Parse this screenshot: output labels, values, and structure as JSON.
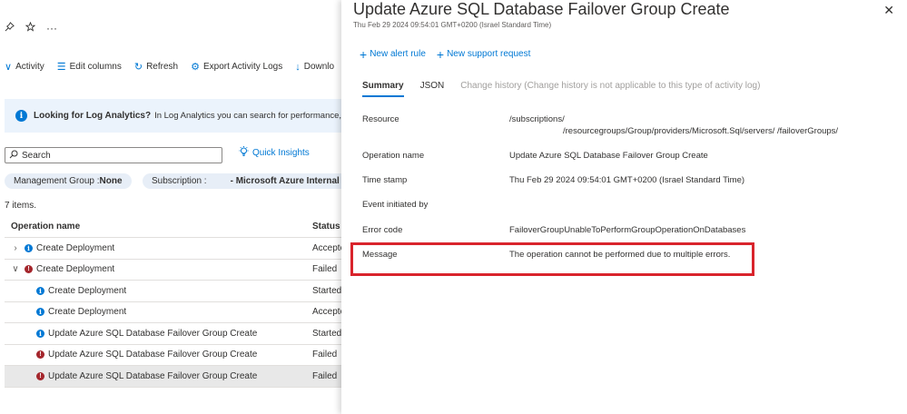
{
  "left": {
    "pin_icons": [
      "pin-icon",
      "star-icon",
      "more-icon"
    ],
    "more_label": "···",
    "toolbar": [
      {
        "label": "Activity",
        "icon": "chevron-down-icon",
        "glyph": "∨"
      },
      {
        "label": "Edit columns",
        "icon": "columns-icon",
        "glyph": "☰"
      },
      {
        "label": "Refresh",
        "icon": "refresh-icon",
        "glyph": "↻"
      },
      {
        "label": "Export Activity Logs",
        "icon": "gear-icon",
        "glyph": "⚙"
      },
      {
        "label": "Downlo",
        "icon": "download-icon",
        "glyph": "↓"
      }
    ],
    "banner": {
      "title": "Looking for Log Analytics?",
      "text": "In Log Analytics you can search for performance, diagn"
    },
    "search": {
      "placeholder": "Search"
    },
    "quick_insights": "Quick Insights",
    "filters": {
      "management_group_label": "Management Group : ",
      "management_group_value": "None",
      "subscription_label": "Subscription : ",
      "subscription_value": "- Microsoft Azure Internal C"
    },
    "items_count": "7 items.",
    "table": {
      "headers": {
        "name": "Operation name",
        "status": "Status"
      },
      "rows": [
        {
          "name": "Create Deployment",
          "status": "Accepte",
          "level": 0,
          "chevron": "›",
          "type": "info"
        },
        {
          "name": "Create Deployment",
          "status": "Failed",
          "level": 0,
          "chevron": "∨",
          "type": "error"
        },
        {
          "name": "Create Deployment",
          "status": "Started",
          "level": 1,
          "chevron": "",
          "type": "info"
        },
        {
          "name": "Create Deployment",
          "status": "Accepte",
          "level": 1,
          "chevron": "",
          "type": "info"
        },
        {
          "name": "Update Azure SQL Database Failover Group Create",
          "status": "Started",
          "level": 1,
          "chevron": "",
          "type": "info"
        },
        {
          "name": "Update Azure SQL Database Failover Group Create",
          "status": "Failed",
          "level": 1,
          "chevron": "",
          "type": "error"
        },
        {
          "name": "Update Azure SQL Database Failover Group Create",
          "status": "Failed",
          "level": 1,
          "chevron": "",
          "type": "error",
          "selected": true
        }
      ]
    }
  },
  "panel": {
    "title": "Update Azure SQL Database Failover Group Create",
    "subtitle": "Thu Feb 29 2024 09:54:01 GMT+0200 (Israel Standard Time)",
    "close_label": "✕",
    "actions": {
      "new_alert_rule": "New alert rule",
      "new_support_request": "New support request"
    },
    "tabs": {
      "summary": "Summary",
      "json": "JSON",
      "change_history": "Change history (Change history is not applicable to this type of activity log)"
    },
    "details": {
      "resource_label": "Resource",
      "resource_line1": "/subscriptions/",
      "resource_line2": "/resourcegroups/Group/providers/Microsoft.Sql/servers/          /failoverGroups/",
      "operation_label": "Operation name",
      "operation_value": "Update Azure SQL Database Failover Group Create",
      "timestamp_label": "Time stamp",
      "timestamp_value": "Thu Feb 29 2024 09:54:01 GMT+0200 (Israel Standard Time)",
      "initiated_label": "Event initiated by",
      "initiated_value": "",
      "error_code_label": "Error code",
      "error_code_value": "FailoverGroupUnableToPerformGroupOperationOnDatabases",
      "message_label": "Message",
      "message_value": "The operation cannot be performed due to multiple errors."
    }
  }
}
